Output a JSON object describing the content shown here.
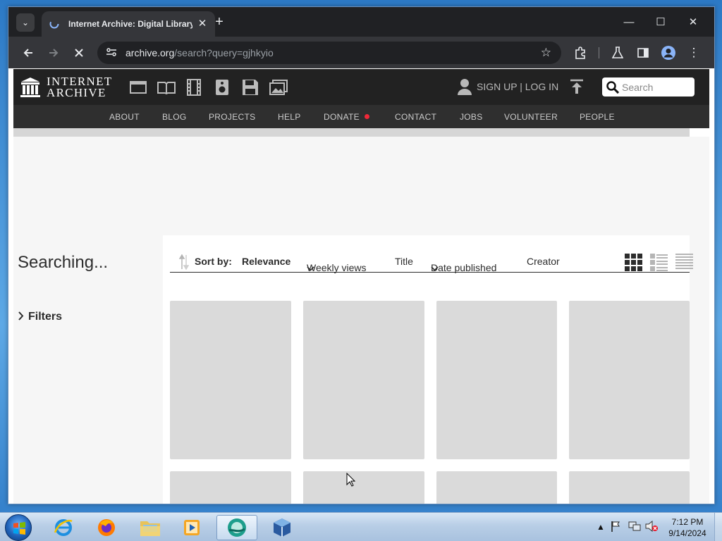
{
  "browser": {
    "tab_title": "Internet Archive: Digital Library",
    "url_host": "archive.org",
    "url_path": "/search?query=gjhkyio"
  },
  "ia": {
    "logo_line1": "INTERNET",
    "logo_line2": "ARCHIVE",
    "signup": "SIGN UP | LOG IN",
    "search_placeholder": "Search",
    "nav": [
      "ABOUT",
      "BLOG",
      "PROJECTS",
      "HELP",
      "DONATE",
      "CONTACT",
      "JOBS",
      "VOLUNTEER",
      "PEOPLE"
    ]
  },
  "page": {
    "status": "Searching...",
    "filters_label": "Filters",
    "sort_label": "Sort by:",
    "sort_options": [
      "Relevance",
      "Weekly views",
      "Title",
      "Date published",
      "Creator"
    ]
  },
  "taskbar": {
    "time": "7:12 PM",
    "date": "9/14/2024"
  },
  "colors": {
    "ia_header": "#222222",
    "ia_nav": "#2f2f2f",
    "donate_dot": "#f02838",
    "placeholder_tile": "#dadada"
  }
}
